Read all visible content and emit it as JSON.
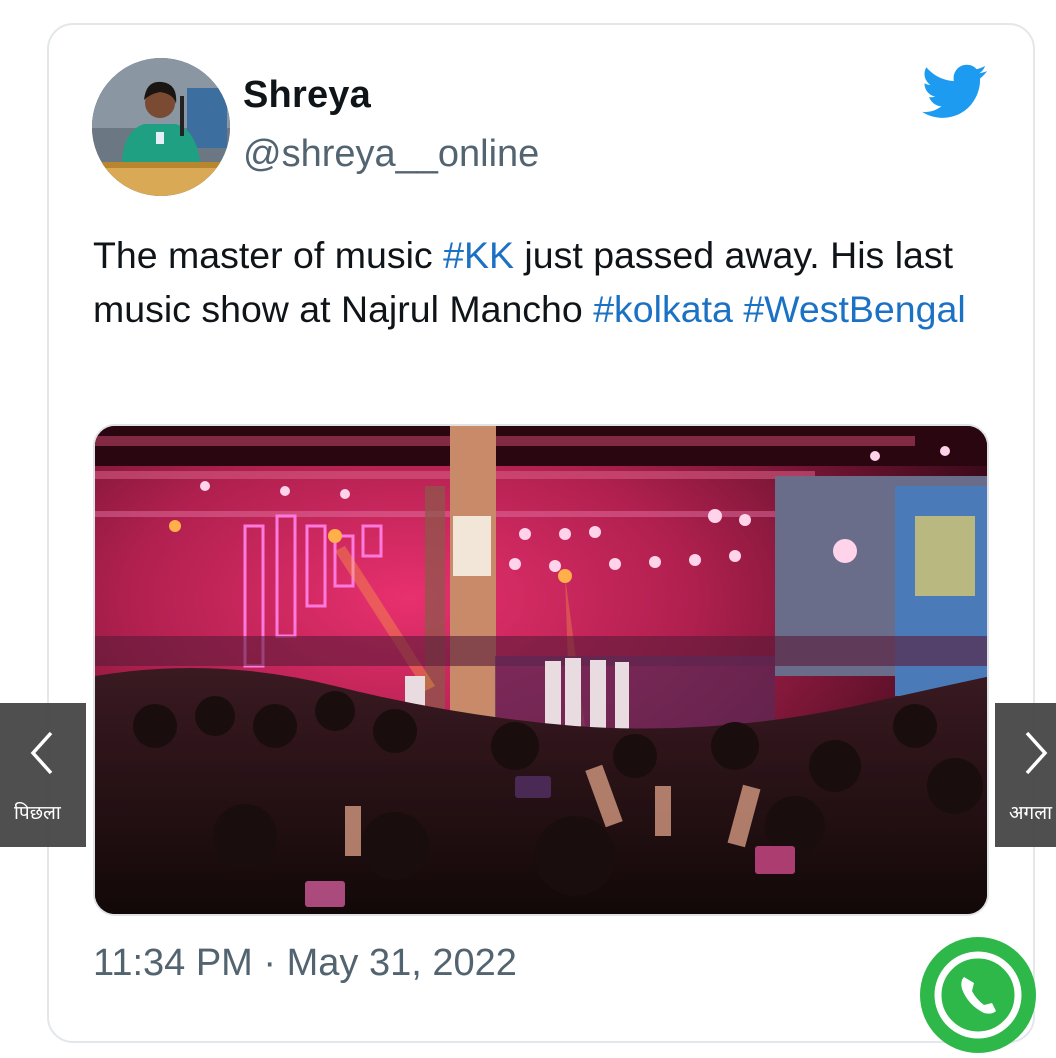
{
  "tweet": {
    "author_name": "Shreya",
    "author_handle": "@shreya__online",
    "text_parts": [
      {
        "text": "The master of music ",
        "tag": false
      },
      {
        "text": "#KK",
        "tag": true
      },
      {
        "text": " just passed away. His last music show at Najrul  Mancho ",
        "tag": false
      },
      {
        "text": "#kolkata",
        "tag": true
      },
      {
        "text": " ",
        "tag": false
      },
      {
        "text": "#WestBengal",
        "tag": true
      }
    ],
    "timestamp": "11:34 PM · May 31, 2022"
  },
  "icons": {
    "brand": "twitter-bird-icon",
    "prev": "chevron-left-icon",
    "next": "chevron-right-icon",
    "floating": "whatsapp-phone-icon"
  },
  "navigation": {
    "prev_label": "पिछला",
    "next_label": "अगला"
  },
  "colors": {
    "hashtag": "#1b71c4",
    "twitter_blue": "#1d9bf0",
    "text_primary": "#0f1419",
    "text_secondary": "#536471",
    "whatsapp_green": "#2eb84a"
  }
}
